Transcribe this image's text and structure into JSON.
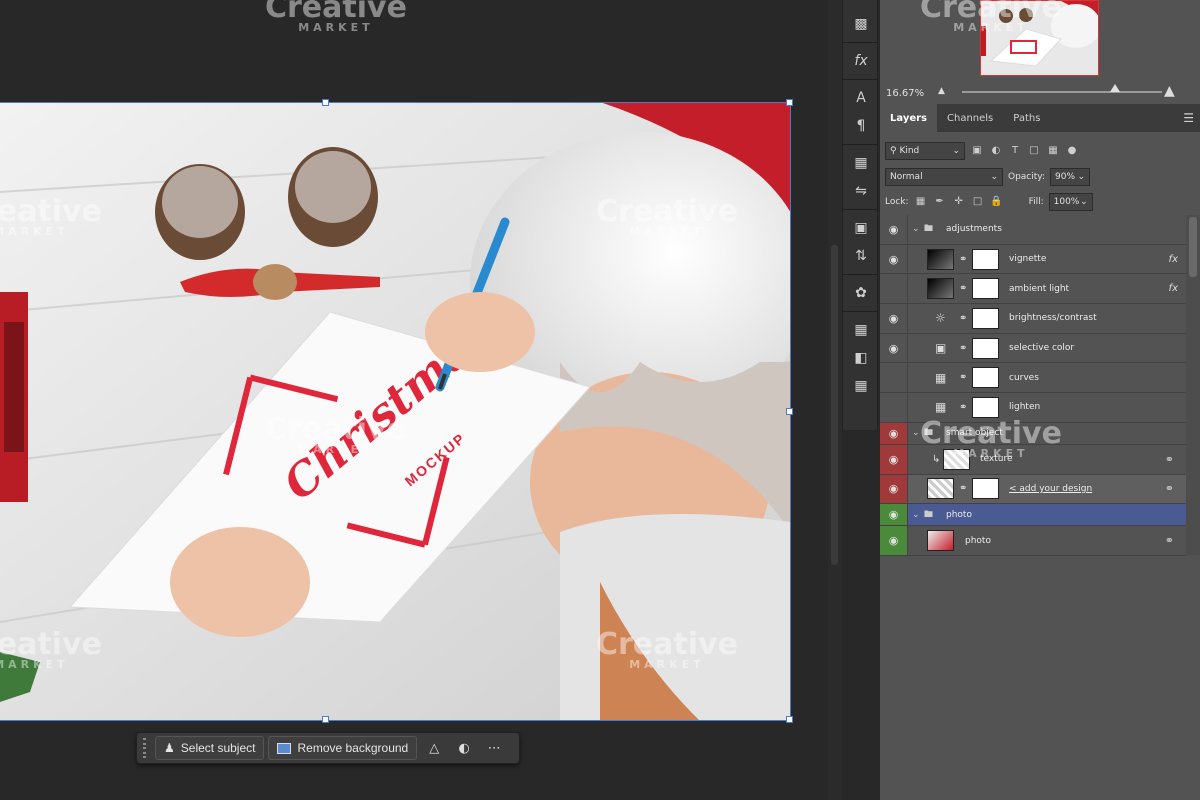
{
  "canvas": {
    "mockup_text_main": "Christmas",
    "mockup_text_sub": "MOCKUP"
  },
  "watermark": {
    "brand": "Creative",
    "sub": "MARKET"
  },
  "taskbar": {
    "select_subject_label": "Select subject",
    "remove_background_label": "Remove background"
  },
  "navigator": {
    "zoom": "16.67%"
  },
  "panel_tabs": [
    "Layers",
    "Channels",
    "Paths"
  ],
  "layers_controls": {
    "filter_kind": "Kind",
    "blend_mode": "Normal",
    "opacity_label": "Opacity:",
    "opacity_value": "90%",
    "lock_label": "Lock:",
    "fill_label": "Fill:",
    "fill_value": "100%"
  },
  "layers": [
    {
      "name": "adjustments",
      "kind": "group",
      "visible": true,
      "color": "none"
    },
    {
      "name": "vignette",
      "kind": "fill",
      "visible": true,
      "fx": "fx",
      "color": "none"
    },
    {
      "name": "ambient light",
      "kind": "fill",
      "visible": false,
      "fx": "fx",
      "color": "none"
    },
    {
      "name": "brightness/contrast",
      "kind": "adjustment",
      "visible": true,
      "color": "none"
    },
    {
      "name": "selective color",
      "kind": "adjustment",
      "visible": true,
      "color": "none"
    },
    {
      "name": "curves",
      "kind": "adjustment",
      "visible": false,
      "color": "none"
    },
    {
      "name": "lighten",
      "kind": "adjustment",
      "visible": false,
      "color": "none"
    },
    {
      "name": "smart object",
      "kind": "group",
      "visible": true,
      "color": "red"
    },
    {
      "name": "texture",
      "kind": "layer",
      "visible": true,
      "color": "red"
    },
    {
      "name": "< add your design",
      "kind": "smart",
      "visible": true,
      "color": "red"
    },
    {
      "name": "photo",
      "kind": "group",
      "visible": true,
      "color": "green",
      "selected": true
    },
    {
      "name": "photo",
      "kind": "layer",
      "visible": true,
      "color": "green"
    }
  ],
  "colors": {
    "canvas_bg": "#282828",
    "panel_bg": "#535353",
    "selection_blue": "#4a5a92",
    "label_red": "#a03a3a",
    "label_green": "#4a8a3a",
    "mockup_red": "#e0263a"
  },
  "icons": {
    "eye": "eye-icon",
    "folder": "folder-icon",
    "chain": "link-icon",
    "fx": "fx-icon"
  }
}
